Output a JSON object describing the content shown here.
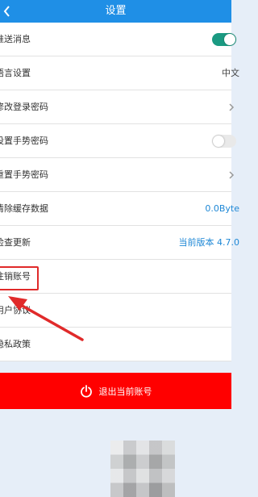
{
  "header": {
    "title": "设置"
  },
  "rows": [
    {
      "label": "推送消息"
    },
    {
      "label": "语言设置",
      "value": "中文"
    },
    {
      "label": "修改登录密码"
    },
    {
      "label": "设置手势密码"
    },
    {
      "label": "重置手势密码"
    },
    {
      "label": "清除缓存数据",
      "value": "0.0Byte"
    },
    {
      "label": "检查更新",
      "value": "当前版本 4.7.0"
    },
    {
      "label": "注销账号"
    },
    {
      "label": "用户协议"
    },
    {
      "label": "隐私政策"
    }
  ],
  "toggles": {
    "push_enabled": true,
    "gesture_enabled": false
  },
  "logout": {
    "label": "退出当前账号"
  },
  "colors": {
    "header_bg": "#1f8fe6",
    "toggle_on": "#1b9a82",
    "link_blue": "#1f88d6",
    "logout_bg": "#ff0000",
    "annotation_red": "#e02a2a"
  },
  "icons": [
    "back-icon",
    "chevron-right-icon",
    "power-icon",
    "annotation-arrow"
  ]
}
